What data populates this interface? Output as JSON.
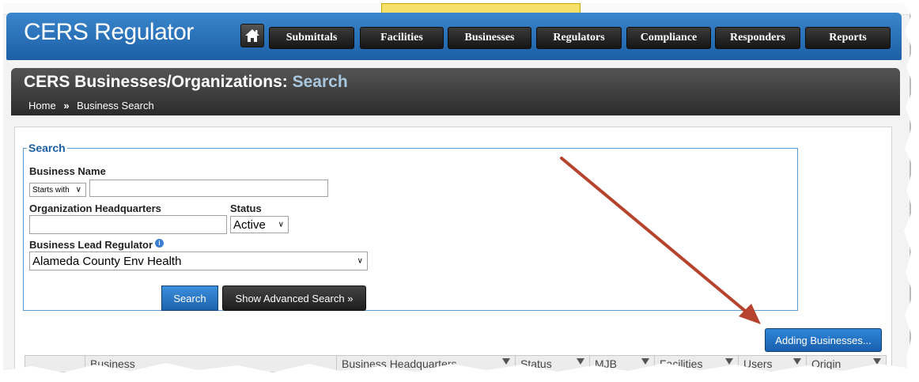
{
  "app": {
    "title": "CERS Regulator"
  },
  "nav": {
    "home_icon": "home-icon",
    "items": [
      {
        "label": "Submittals",
        "active": false
      },
      {
        "label": "Facilities",
        "active": false
      },
      {
        "label": "Businesses",
        "active": true
      },
      {
        "label": "Regulators",
        "active": false
      },
      {
        "label": "Compliance",
        "active": false
      },
      {
        "label": "Responders",
        "active": false
      },
      {
        "label": "Reports",
        "active": false
      }
    ]
  },
  "page": {
    "title": "CERS Businesses/Organizations:",
    "title_sub": "Search",
    "breadcrumb": {
      "home": "Home",
      "separator": "»",
      "current": "Business Search"
    }
  },
  "search": {
    "legend": "Search",
    "business_name": {
      "label": "Business Name",
      "match_mode": "Starts with",
      "value": ""
    },
    "org_headquarters": {
      "label": "Organization Headquarters",
      "value": ""
    },
    "status": {
      "label": "Status",
      "value": "Active"
    },
    "lead_regulator": {
      "label": "Business Lead Regulator",
      "value": "Alameda County Env Health",
      "info_icon": "info-icon"
    },
    "search_button": "Search",
    "advanced_button": "Show Advanced Search »"
  },
  "adding_button": "Adding Businesses...",
  "table": {
    "columns": [
      "Business",
      "Business Headquarters",
      "Status",
      "MJB",
      "Facilities",
      "Users",
      "Origin"
    ]
  },
  "colors": {
    "header_blue": "#1c5fa6",
    "nav_black": "#1d1d1d",
    "annotation_arrow": "#b5432d"
  }
}
